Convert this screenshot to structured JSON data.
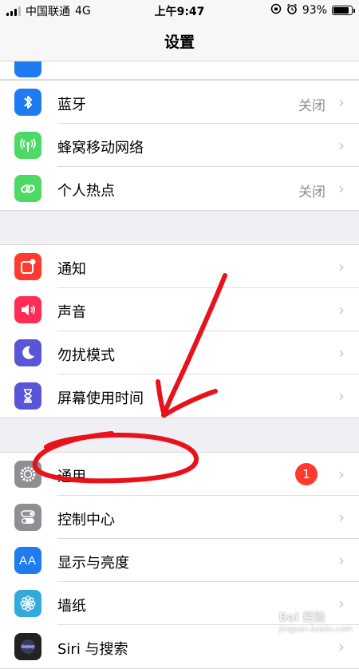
{
  "status_bar": {
    "carrier": "中国联通",
    "network": "4G",
    "time": "上午9:47",
    "battery_percent": "93%",
    "battery_level": 0.93,
    "icons": [
      "orientation-lock-icon",
      "alarm-icon"
    ]
  },
  "nav": {
    "title": "设置"
  },
  "groups": {
    "connectivity": [
      {
        "label": "蓝牙",
        "value": "关闭",
        "icon": "bluetooth-icon",
        "color": "#1e7cf0"
      },
      {
        "label": "蜂窝移动网络",
        "icon": "cellular-antenna-icon",
        "color": "#4cd964"
      },
      {
        "label": "个人热点",
        "value": "关闭",
        "icon": "hotspot-link-icon",
        "color": "#4cd964"
      }
    ],
    "notifications": [
      {
        "label": "通知",
        "icon": "notifications-icon",
        "color": "#ff3b30"
      },
      {
        "label": "声音",
        "icon": "speaker-icon",
        "color": "#ff2d55"
      },
      {
        "label": "勿扰模式",
        "icon": "moon-icon",
        "color": "#5856d6"
      },
      {
        "label": "屏幕使用时间",
        "icon": "hourglass-icon",
        "color": "#5856d6"
      }
    ],
    "general": [
      {
        "label": "通用",
        "badge": "1",
        "icon": "gear-icon",
        "color": "#8e8e93"
      },
      {
        "label": "控制中心",
        "icon": "toggles-icon",
        "color": "#8e8e93"
      },
      {
        "label": "显示与亮度",
        "icon": "text-size-icon",
        "icon_text": "AA",
        "color": "#1e7cf0"
      },
      {
        "label": "墙纸",
        "icon": "flower-icon",
        "color": "#34aadc"
      },
      {
        "label": "Siri 与搜索",
        "icon": "siri-icon",
        "color": "#222222"
      }
    ]
  },
  "watermark": {
    "text": "Bai 经验",
    "url": "jingyan.baidu.com"
  }
}
